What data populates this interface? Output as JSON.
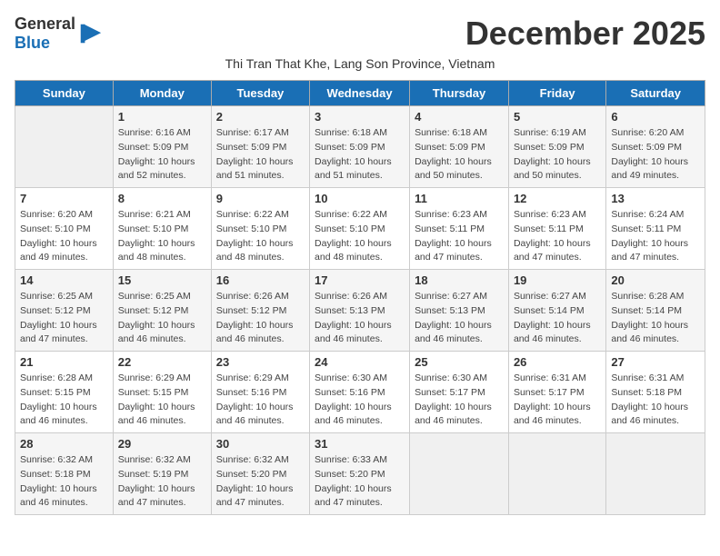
{
  "logo": {
    "text_general": "General",
    "text_blue": "Blue"
  },
  "month_title": "December 2025",
  "subtitle": "Thi Tran That Khe, Lang Son Province, Vietnam",
  "days_of_week": [
    "Sunday",
    "Monday",
    "Tuesday",
    "Wednesday",
    "Thursday",
    "Friday",
    "Saturday"
  ],
  "weeks": [
    [
      {
        "day": "",
        "sunrise": "",
        "sunset": "",
        "daylight": ""
      },
      {
        "day": "1",
        "sunrise": "Sunrise: 6:16 AM",
        "sunset": "Sunset: 5:09 PM",
        "daylight": "Daylight: 10 hours and 52 minutes."
      },
      {
        "day": "2",
        "sunrise": "Sunrise: 6:17 AM",
        "sunset": "Sunset: 5:09 PM",
        "daylight": "Daylight: 10 hours and 51 minutes."
      },
      {
        "day": "3",
        "sunrise": "Sunrise: 6:18 AM",
        "sunset": "Sunset: 5:09 PM",
        "daylight": "Daylight: 10 hours and 51 minutes."
      },
      {
        "day": "4",
        "sunrise": "Sunrise: 6:18 AM",
        "sunset": "Sunset: 5:09 PM",
        "daylight": "Daylight: 10 hours and 50 minutes."
      },
      {
        "day": "5",
        "sunrise": "Sunrise: 6:19 AM",
        "sunset": "Sunset: 5:09 PM",
        "daylight": "Daylight: 10 hours and 50 minutes."
      },
      {
        "day": "6",
        "sunrise": "Sunrise: 6:20 AM",
        "sunset": "Sunset: 5:09 PM",
        "daylight": "Daylight: 10 hours and 49 minutes."
      }
    ],
    [
      {
        "day": "7",
        "sunrise": "Sunrise: 6:20 AM",
        "sunset": "Sunset: 5:10 PM",
        "daylight": "Daylight: 10 hours and 49 minutes."
      },
      {
        "day": "8",
        "sunrise": "Sunrise: 6:21 AM",
        "sunset": "Sunset: 5:10 PM",
        "daylight": "Daylight: 10 hours and 48 minutes."
      },
      {
        "day": "9",
        "sunrise": "Sunrise: 6:22 AM",
        "sunset": "Sunset: 5:10 PM",
        "daylight": "Daylight: 10 hours and 48 minutes."
      },
      {
        "day": "10",
        "sunrise": "Sunrise: 6:22 AM",
        "sunset": "Sunset: 5:10 PM",
        "daylight": "Daylight: 10 hours and 48 minutes."
      },
      {
        "day": "11",
        "sunrise": "Sunrise: 6:23 AM",
        "sunset": "Sunset: 5:11 PM",
        "daylight": "Daylight: 10 hours and 47 minutes."
      },
      {
        "day": "12",
        "sunrise": "Sunrise: 6:23 AM",
        "sunset": "Sunset: 5:11 PM",
        "daylight": "Daylight: 10 hours and 47 minutes."
      },
      {
        "day": "13",
        "sunrise": "Sunrise: 6:24 AM",
        "sunset": "Sunset: 5:11 PM",
        "daylight": "Daylight: 10 hours and 47 minutes."
      }
    ],
    [
      {
        "day": "14",
        "sunrise": "Sunrise: 6:25 AM",
        "sunset": "Sunset: 5:12 PM",
        "daylight": "Daylight: 10 hours and 47 minutes."
      },
      {
        "day": "15",
        "sunrise": "Sunrise: 6:25 AM",
        "sunset": "Sunset: 5:12 PM",
        "daylight": "Daylight: 10 hours and 46 minutes."
      },
      {
        "day": "16",
        "sunrise": "Sunrise: 6:26 AM",
        "sunset": "Sunset: 5:12 PM",
        "daylight": "Daylight: 10 hours and 46 minutes."
      },
      {
        "day": "17",
        "sunrise": "Sunrise: 6:26 AM",
        "sunset": "Sunset: 5:13 PM",
        "daylight": "Daylight: 10 hours and 46 minutes."
      },
      {
        "day": "18",
        "sunrise": "Sunrise: 6:27 AM",
        "sunset": "Sunset: 5:13 PM",
        "daylight": "Daylight: 10 hours and 46 minutes."
      },
      {
        "day": "19",
        "sunrise": "Sunrise: 6:27 AM",
        "sunset": "Sunset: 5:14 PM",
        "daylight": "Daylight: 10 hours and 46 minutes."
      },
      {
        "day": "20",
        "sunrise": "Sunrise: 6:28 AM",
        "sunset": "Sunset: 5:14 PM",
        "daylight": "Daylight: 10 hours and 46 minutes."
      }
    ],
    [
      {
        "day": "21",
        "sunrise": "Sunrise: 6:28 AM",
        "sunset": "Sunset: 5:15 PM",
        "daylight": "Daylight: 10 hours and 46 minutes."
      },
      {
        "day": "22",
        "sunrise": "Sunrise: 6:29 AM",
        "sunset": "Sunset: 5:15 PM",
        "daylight": "Daylight: 10 hours and 46 minutes."
      },
      {
        "day": "23",
        "sunrise": "Sunrise: 6:29 AM",
        "sunset": "Sunset: 5:16 PM",
        "daylight": "Daylight: 10 hours and 46 minutes."
      },
      {
        "day": "24",
        "sunrise": "Sunrise: 6:30 AM",
        "sunset": "Sunset: 5:16 PM",
        "daylight": "Daylight: 10 hours and 46 minutes."
      },
      {
        "day": "25",
        "sunrise": "Sunrise: 6:30 AM",
        "sunset": "Sunset: 5:17 PM",
        "daylight": "Daylight: 10 hours and 46 minutes."
      },
      {
        "day": "26",
        "sunrise": "Sunrise: 6:31 AM",
        "sunset": "Sunset: 5:17 PM",
        "daylight": "Daylight: 10 hours and 46 minutes."
      },
      {
        "day": "27",
        "sunrise": "Sunrise: 6:31 AM",
        "sunset": "Sunset: 5:18 PM",
        "daylight": "Daylight: 10 hours and 46 minutes."
      }
    ],
    [
      {
        "day": "28",
        "sunrise": "Sunrise: 6:32 AM",
        "sunset": "Sunset: 5:18 PM",
        "daylight": "Daylight: 10 hours and 46 minutes."
      },
      {
        "day": "29",
        "sunrise": "Sunrise: 6:32 AM",
        "sunset": "Sunset: 5:19 PM",
        "daylight": "Daylight: 10 hours and 47 minutes."
      },
      {
        "day": "30",
        "sunrise": "Sunrise: 6:32 AM",
        "sunset": "Sunset: 5:20 PM",
        "daylight": "Daylight: 10 hours and 47 minutes."
      },
      {
        "day": "31",
        "sunrise": "Sunrise: 6:33 AM",
        "sunset": "Sunset: 5:20 PM",
        "daylight": "Daylight: 10 hours and 47 minutes."
      },
      {
        "day": "",
        "sunrise": "",
        "sunset": "",
        "daylight": ""
      },
      {
        "day": "",
        "sunrise": "",
        "sunset": "",
        "daylight": ""
      },
      {
        "day": "",
        "sunrise": "",
        "sunset": "",
        "daylight": ""
      }
    ]
  ]
}
